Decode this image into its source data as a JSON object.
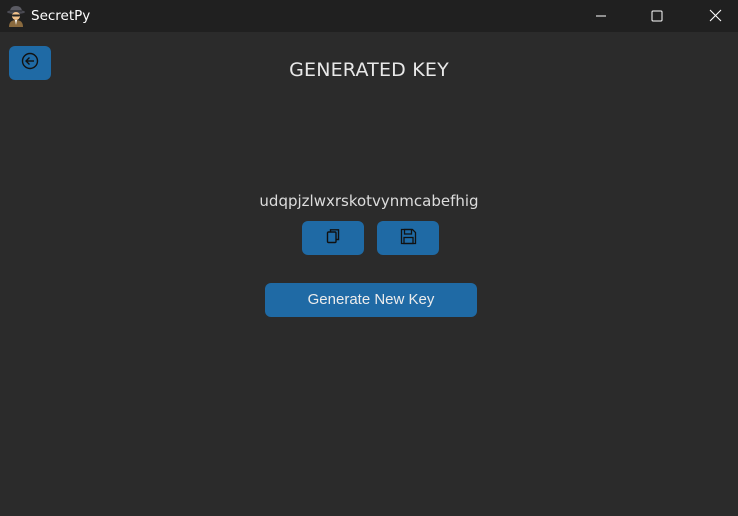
{
  "window": {
    "app_title": "SecretPy",
    "app_icon": "spy-detective-icon",
    "controls": {
      "minimize_icon": "minimize-icon",
      "maximize_icon": "maximize-icon",
      "close_icon": "close-icon"
    }
  },
  "header": {
    "back_icon": "arrow-left-circle-icon",
    "title": "GENERATED KEY"
  },
  "main": {
    "generated_key": "udqpjzlwxrskotvynmcabefhig",
    "copy_icon": "copy-icon",
    "save_icon": "save-floppy-icon",
    "generate_button_label": "Generate New Key"
  },
  "colors": {
    "background": "#2b2b2b",
    "titlebar": "#202020",
    "accent": "#1f6aa5",
    "text": "#e8e8e8"
  }
}
